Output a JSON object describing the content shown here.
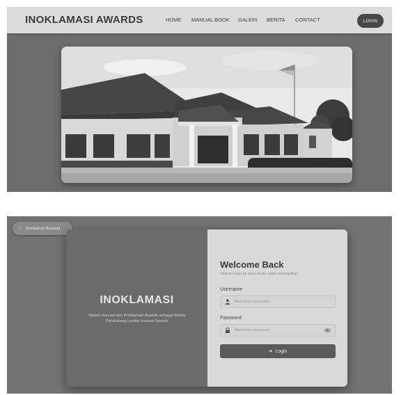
{
  "navbar": {
    "brand": "INOKLAMASI AWARDS",
    "links": [
      "HOME",
      "MANUAL BOOK",
      "GALERI",
      "BERITA",
      "CONTACT"
    ],
    "login_label": "LOGIN"
  },
  "hero": {
    "image_icon": "building-photo"
  },
  "login_page": {
    "back_label": "Kembali ke Beranda",
    "brand_title": "INOKLAMASI",
    "brand_description": "Sistem Inovasi dan Proklamasi Awards sebagai Media Pendukung Lomba Inovasi Daerah",
    "welcome_title": "Welcome Back",
    "welcome_subtitle": "Silakan login ke akun Anda untuk melanjutkan",
    "username_label": "Username",
    "username_placeholder": "Masukkan username",
    "password_label": "Password",
    "password_placeholder": "Masukkan password",
    "submit_label": "Login"
  }
}
